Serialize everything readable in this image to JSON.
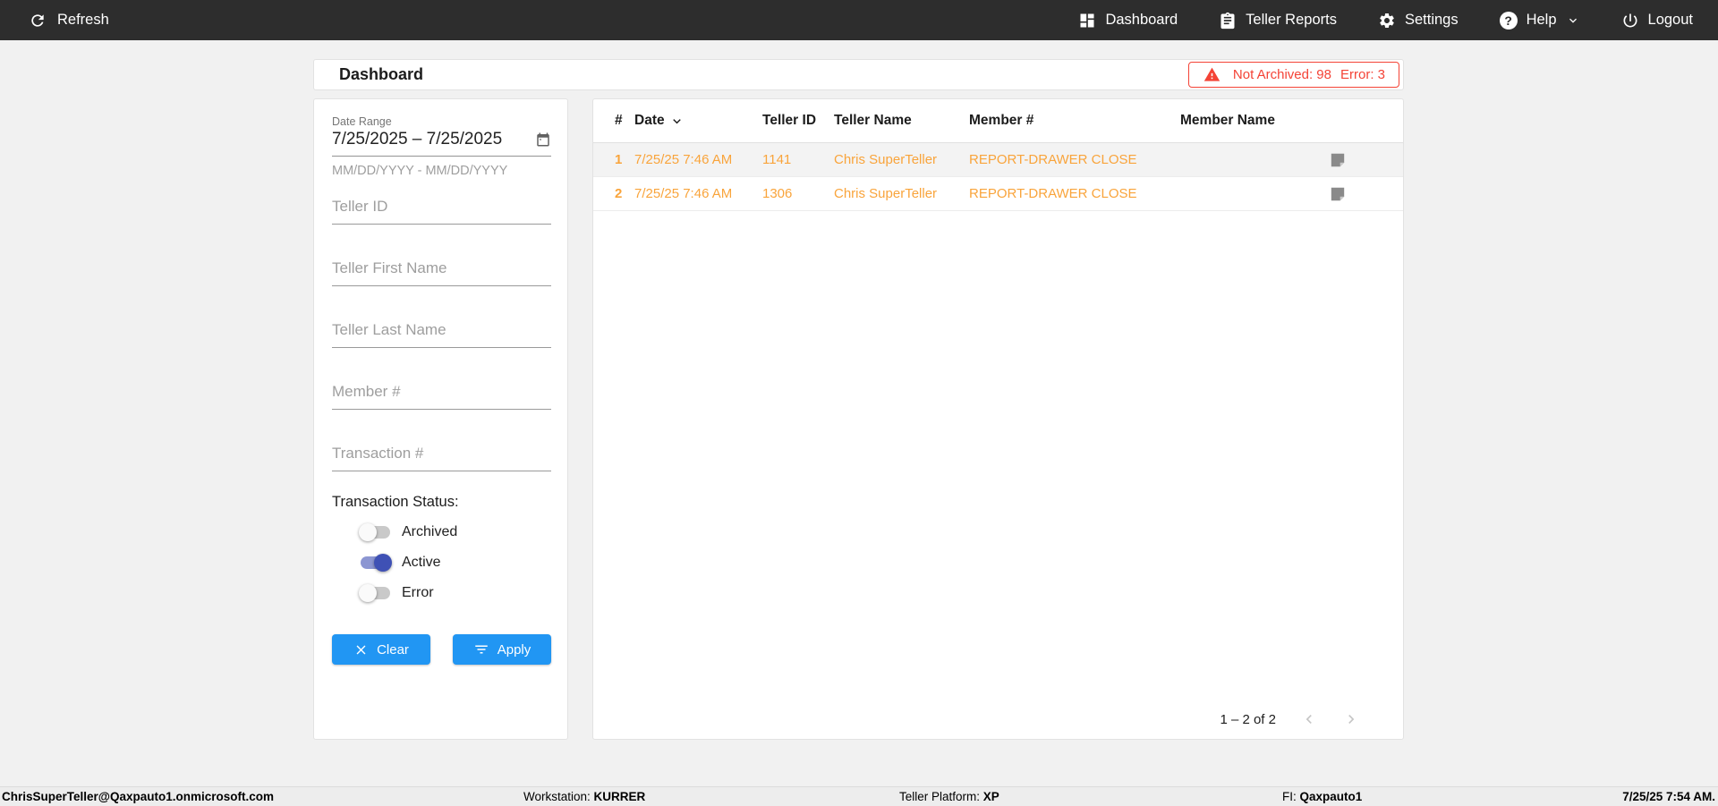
{
  "navbar": {
    "refresh_label": "Refresh",
    "items": [
      {
        "label": "Dashboard",
        "icon": "dashboard-icon"
      },
      {
        "label": "Teller Reports",
        "icon": "clipboard-icon"
      },
      {
        "label": "Settings",
        "icon": "gear-icon"
      },
      {
        "label": "Help",
        "icon": "help-icon"
      },
      {
        "label": "Logout",
        "icon": "power-icon"
      }
    ]
  },
  "header": {
    "title": "Dashboard",
    "alert": {
      "not_archived": "Not Archived: 98",
      "error": "Error: 3"
    }
  },
  "filters": {
    "date_range": {
      "label": "Date Range",
      "value": "7/25/2025 – 7/25/2025",
      "hint": "MM/DD/YYYY - MM/DD/YYYY"
    },
    "fields": [
      {
        "placeholder": "Teller ID"
      },
      {
        "placeholder": "Teller First Name"
      },
      {
        "placeholder": "Teller Last Name"
      },
      {
        "placeholder": "Member #"
      },
      {
        "placeholder": "Transaction #"
      }
    ],
    "status": {
      "label": "Transaction Status:",
      "toggles": [
        {
          "label": "Archived",
          "on": false
        },
        {
          "label": "Active",
          "on": true
        },
        {
          "label": "Error",
          "on": false
        }
      ]
    },
    "buttons": {
      "clear": "Clear",
      "apply": "Apply"
    }
  },
  "table": {
    "columns": {
      "num": "#",
      "date": "Date",
      "teller_id": "Teller ID",
      "teller_name": "Teller Name",
      "member_num": "Member #",
      "member_name": "Member Name"
    },
    "rows": [
      {
        "num": "1",
        "date": "7/25/25 7:46 AM",
        "teller_id": "1141",
        "teller_name": "Chris SuperTeller",
        "member_num": "REPORT-DRAWER CLOSE",
        "member_name": "",
        "note_icon": "note-icon"
      },
      {
        "num": "2",
        "date": "7/25/25 7:46 AM",
        "teller_id": "1306",
        "teller_name": "Chris SuperTeller",
        "member_num": "REPORT-DRAWER CLOSE",
        "member_name": "",
        "note_icon": "note-icon"
      }
    ],
    "pagination": {
      "range": "1 – 2 of 2"
    }
  },
  "footer": {
    "user": "ChrisSuperTeller@Qaxpauto1.onmicrosoft.com",
    "workstation_label": "Workstation: ",
    "workstation": "KURRER",
    "platform_label": "Teller Platform: ",
    "platform": "XP",
    "fi_label": "FI: ",
    "fi": "Qaxpauto1",
    "datetime": "7/25/25 7:54 AM."
  },
  "colors": {
    "navbar_bg": "#2d2d2d",
    "accent_blue": "#2196f3",
    "alert_red": "#f44336",
    "row_orange": "#f9a43b",
    "toggle_on_indigo": "#3f51b5"
  }
}
